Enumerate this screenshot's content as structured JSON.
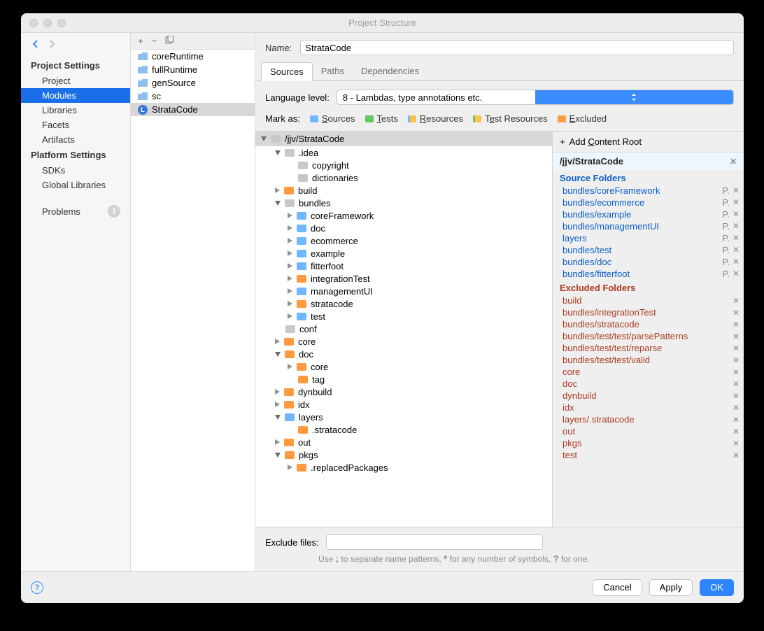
{
  "window_title": "Project Structure",
  "sidebar": {
    "nav_back": "←",
    "nav_fwd": "→",
    "section1": "Project Settings",
    "items1": [
      "Project",
      "Modules",
      "Libraries",
      "Facets",
      "Artifacts"
    ],
    "selected1": 1,
    "section2": "Platform Settings",
    "items2": [
      "SDKs",
      "Global Libraries"
    ],
    "problems_label": "Problems",
    "problems_count": "1"
  },
  "modules": {
    "list": [
      {
        "name": "coreRuntime",
        "type": "folder"
      },
      {
        "name": "fullRuntime",
        "type": "folder"
      },
      {
        "name": "genSource",
        "type": "folder"
      },
      {
        "name": "sc",
        "type": "folder"
      },
      {
        "name": "StrataCode",
        "type": "lib"
      }
    ],
    "selected": 4
  },
  "detail": {
    "name_label": "Name:",
    "name_value": "StrataCode",
    "tabs": [
      "Sources",
      "Paths",
      "Dependencies"
    ],
    "active_tab": 0,
    "lang_label": "Language level:",
    "lang_value": "8 - Lambdas, type annotations etc.",
    "mark_label": "Mark as:",
    "mark_options": [
      "Sources",
      "Tests",
      "Resources",
      "Test Resources",
      "Excluded"
    ],
    "tree_root": "/jjv/StrataCode",
    "tree": [
      {
        "d": 1,
        "exp": "down",
        "c": "gray",
        "n": ".idea"
      },
      {
        "d": 2,
        "exp": "",
        "c": "gray",
        "n": "copyright"
      },
      {
        "d": 2,
        "exp": "",
        "c": "gray",
        "n": "dictionaries"
      },
      {
        "d": 1,
        "exp": "right",
        "c": "orange",
        "n": "build"
      },
      {
        "d": 1,
        "exp": "down",
        "c": "gray",
        "n": "bundles"
      },
      {
        "d": 2,
        "exp": "right",
        "c": "blue",
        "n": "coreFramework"
      },
      {
        "d": 2,
        "exp": "right",
        "c": "blue",
        "n": "doc"
      },
      {
        "d": 2,
        "exp": "right",
        "c": "blue",
        "n": "ecommerce"
      },
      {
        "d": 2,
        "exp": "right",
        "c": "blue",
        "n": "example"
      },
      {
        "d": 2,
        "exp": "right",
        "c": "blue",
        "n": "fitterfoot"
      },
      {
        "d": 2,
        "exp": "right",
        "c": "orange",
        "n": "integrationTest"
      },
      {
        "d": 2,
        "exp": "right",
        "c": "blue",
        "n": "managementUI"
      },
      {
        "d": 2,
        "exp": "right",
        "c": "orange",
        "n": "stratacode"
      },
      {
        "d": 2,
        "exp": "right",
        "c": "blue",
        "n": "test"
      },
      {
        "d": 1,
        "exp": "",
        "c": "gray",
        "n": "conf"
      },
      {
        "d": 1,
        "exp": "right",
        "c": "orange",
        "n": "core"
      },
      {
        "d": 1,
        "exp": "down",
        "c": "orange",
        "n": "doc"
      },
      {
        "d": 2,
        "exp": "right",
        "c": "orange",
        "n": "core"
      },
      {
        "d": 2,
        "exp": "",
        "c": "orange",
        "n": "tag"
      },
      {
        "d": 1,
        "exp": "right",
        "c": "orange",
        "n": "dynbuild"
      },
      {
        "d": 1,
        "exp": "right",
        "c": "orange",
        "n": "idx"
      },
      {
        "d": 1,
        "exp": "down",
        "c": "blue",
        "n": "layers"
      },
      {
        "d": 2,
        "exp": "",
        "c": "orange",
        "n": ".stratacode"
      },
      {
        "d": 1,
        "exp": "right",
        "c": "orange",
        "n": "out"
      },
      {
        "d": 1,
        "exp": "down",
        "c": "orange",
        "n": "pkgs"
      },
      {
        "d": 2,
        "exp": "right",
        "c": "orange",
        "n": ".replacedPackages"
      }
    ],
    "add_root": "Add Content Root",
    "content_root": "/jjv/StrataCode",
    "src_header": "Source Folders",
    "src_folders": [
      "bundles/coreFramework",
      "bundles/ecommerce",
      "bundles/example",
      "bundles/managementUI",
      "layers",
      "bundles/test",
      "bundles/doc",
      "bundles/fitterfoot"
    ],
    "exc_header": "Excluded Folders",
    "exc_folders": [
      "build",
      "bundles/integrationTest",
      "bundles/stratacode",
      "bundles/test/test/parsePatterns",
      "bundles/test/test/reparse",
      "bundles/test/test/valid",
      "core",
      "doc",
      "dynbuild",
      "idx",
      "layers/.stratacode",
      "out",
      "pkgs",
      "test"
    ],
    "exclude_label": "Exclude files:",
    "exclude_hint": "Use ; to separate name patterns, * for any number of symbols, ? for one."
  },
  "footer": {
    "cancel": "Cancel",
    "apply": "Apply",
    "ok": "OK"
  }
}
